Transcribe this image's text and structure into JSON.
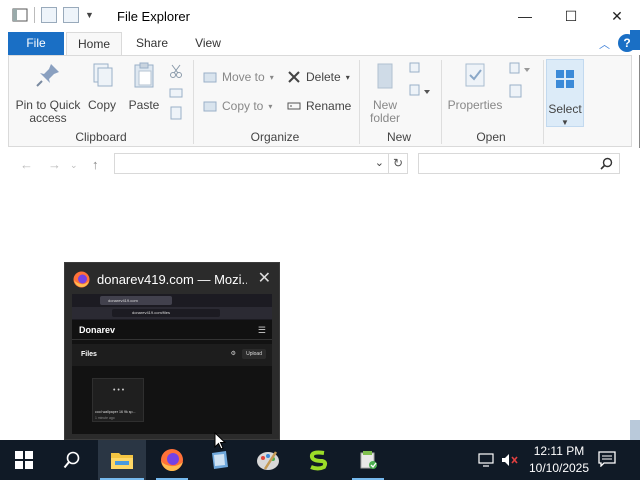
{
  "window": {
    "title": "File Explorer",
    "caption": {
      "minimize": "—",
      "maximize": "☐",
      "close": "✕"
    }
  },
  "ribbon_tabs": [
    {
      "label": "File"
    },
    {
      "label": "Home"
    },
    {
      "label": "Share"
    },
    {
      "label": "View"
    }
  ],
  "help_label": "?",
  "ribbon": {
    "clipboard": {
      "pin_to_quick_access": "Pin to Quick access",
      "copy": "Copy",
      "paste": "Paste",
      "group_label": "Clipboard"
    },
    "organize": {
      "move_to": "Move to",
      "copy_to": "Copy to",
      "delete": "Delete",
      "rename": "Rename",
      "group_label": "Organize"
    },
    "new": {
      "new_folder": "New folder",
      "group_label": "New"
    },
    "open": {
      "properties": "Properties",
      "group_label": "Open"
    },
    "select": {
      "select": "Select"
    }
  },
  "navigation": {
    "address_value": "",
    "search_value": ""
  },
  "thumbnail": {
    "title": "donarev419.com — Mozi...",
    "close": "✕",
    "preview": {
      "tab_title": "donarev419.com",
      "url": "donarev419.com/files",
      "brand": "Donarev",
      "section": "Files",
      "upload": "Upload",
      "card_dots": "• • •",
      "card_name": "cool wallpaper 16 9k sp...",
      "card_meta": "1 minute ago"
    }
  },
  "taskbar": {
    "time": "12:11 PM",
    "date": "10/10/2025",
    "apps": [
      "start",
      "search",
      "file-explorer",
      "firefox",
      "notepad",
      "paint",
      "app-s",
      "installer"
    ]
  },
  "colors": {
    "accent": "#1a6fc5",
    "taskbar": "#101a26",
    "thumbnail_bg": "#2b2b2b"
  }
}
